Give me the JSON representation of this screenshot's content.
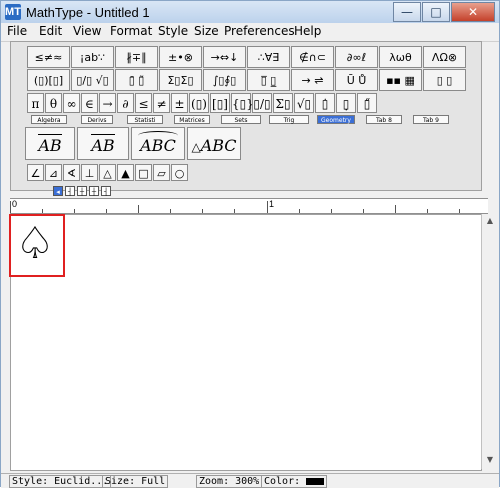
{
  "window": {
    "app_icon": "MT",
    "title": "MathType - Untitled 1",
    "buttons": {
      "minimize": "—",
      "maximize": "□",
      "close": "✕"
    }
  },
  "menu": [
    "File",
    "Edit",
    "View",
    "Format",
    "Style",
    "Size",
    "Preferences",
    "Help"
  ],
  "palettes_row1": [
    "≤≠≈",
    "¡ab∵",
    "∦∓∥",
    "±•⊗",
    "→⇔↓",
    "∴∀∃",
    "∉∩⊂",
    "∂∞ℓ",
    "λωθ",
    "ΛΩ⊗"
  ],
  "palettes_row2": [
    "(▯)[▯]",
    "▯/▯ √▯",
    "▯̄ ▯̃",
    "Σ▯Σ▯",
    "∫▯∮▯",
    "▯̅ ▯̲",
    "→ ⇌",
    "Ū Ů",
    "▪▪ ▦",
    "▯ ▯"
  ],
  "symbols_row": [
    "π",
    "θ",
    "∞",
    "∈",
    "→",
    "∂",
    "≤",
    "≠",
    "±",
    "(▯)",
    "[▯]",
    "{▯}",
    "▯/▯",
    "Σ▯",
    "√▯",
    "▯̇",
    "▯̣",
    "▯̋"
  ],
  "tabs": [
    {
      "label": "Algebra",
      "active": false
    },
    {
      "label": "Derivs",
      "active": false
    },
    {
      "label": "Statisti",
      "active": false
    },
    {
      "label": "Matrices",
      "active": false
    },
    {
      "label": "Sets",
      "active": false
    },
    {
      "label": "Trig",
      "active": false
    },
    {
      "label": "Geometry",
      "active": true
    },
    {
      "label": "Tab 8",
      "active": false
    },
    {
      "label": "Tab 9",
      "active": false
    }
  ],
  "templates": [
    "AB",
    "AB",
    "ABC",
    "ABC"
  ],
  "geometry_icons": [
    "∠",
    "⊿",
    "∢",
    "⊥",
    "△",
    "▲",
    "□",
    "▱",
    "○"
  ],
  "ruler": {
    "marks": [
      "0",
      "1"
    ],
    "buttons": [
      "◂",
      "┤",
      "┼",
      "┼",
      "┤"
    ]
  },
  "document": {
    "content_symbol": "♤"
  },
  "status": {
    "style": "Style: Euclid...",
    "size": "Size: Full",
    "zoom": "Zoom: 300%",
    "color_label": "Color:",
    "color_value": "#000000"
  }
}
